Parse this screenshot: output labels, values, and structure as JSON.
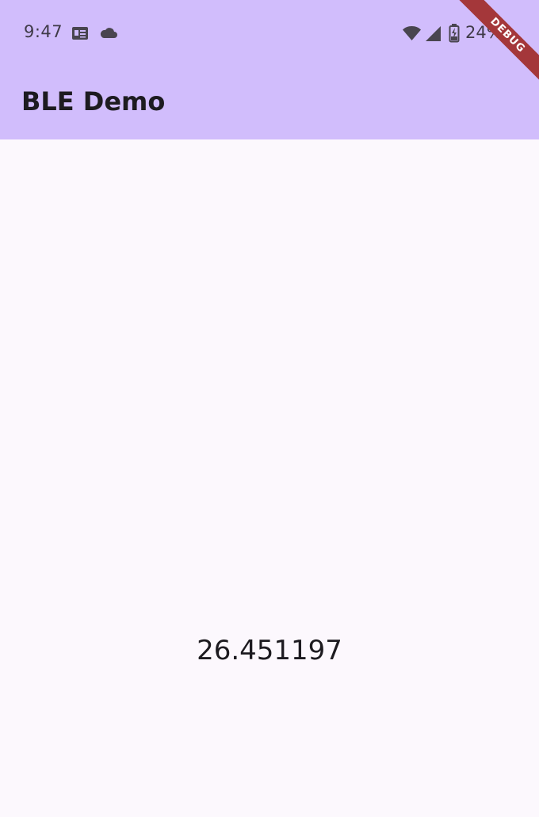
{
  "status_bar": {
    "time": "9:47",
    "battery_percent": "24%",
    "icons": [
      "news-icon",
      "cloud-icon",
      "wifi-icon",
      "signal-icon",
      "battery-charging-icon"
    ]
  },
  "app_bar": {
    "title": "BLE Demo"
  },
  "debug_banner": {
    "label": "DEBUG"
  },
  "main": {
    "value": "26.451197"
  },
  "colors": {
    "app_bar_background": "#d1bdfc",
    "page_background": "#fcf8fd",
    "text_primary": "#1d1b20",
    "debug_banner": "#a4373a"
  }
}
